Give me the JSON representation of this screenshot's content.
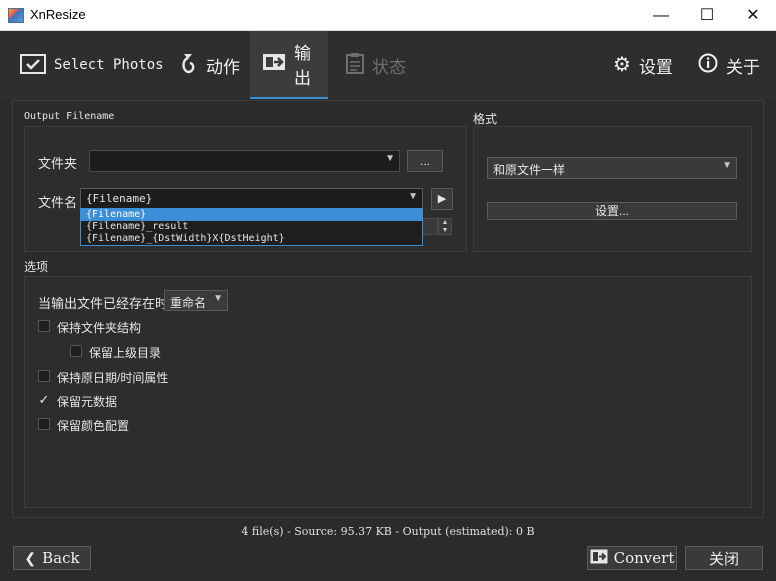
{
  "window": {
    "title": "XnResize",
    "minimize_glyph": "—",
    "maximize_glyph": "☐",
    "close_glyph": "✕"
  },
  "tabs": [
    {
      "label": "Select Photos",
      "icon": "select-photos-icon",
      "state": "normal"
    },
    {
      "label": "动作",
      "icon": "action-icon",
      "state": "normal"
    },
    {
      "label": "输出",
      "icon": "output-icon",
      "state": "active"
    },
    {
      "label": "状态",
      "icon": "status-icon",
      "state": "disabled"
    },
    {
      "label": "设置",
      "icon": "gear-icon",
      "state": "normal"
    },
    {
      "label": "关于",
      "icon": "info-icon",
      "state": "normal"
    }
  ],
  "output_filename": {
    "section_title": "Output Filename",
    "folder_label": "文件夹",
    "folder_value": "",
    "browse_label": "...",
    "filename_label": "文件名",
    "filename_value": "{Filename}",
    "dropdown_options": [
      "{Filename}",
      "{Filename}_result",
      "{Filename}_{DstWidth}X{DstHeight}"
    ],
    "selected_option_index": 0
  },
  "format": {
    "section_title": "格式",
    "value": "和原文件一样",
    "settings_button": "设置..."
  },
  "options": {
    "section_title": "选项",
    "exists_label": "当输出文件已经存在时",
    "exists_value": "重命名",
    "checkboxes": [
      {
        "label": "保持文件夹结构",
        "checked": false
      },
      {
        "label": "保留上级目录",
        "checked": false
      },
      {
        "label": "保持原日期/时间属性",
        "checked": false
      },
      {
        "label": "保留元数据",
        "checked": true
      },
      {
        "label": "保留颜色配置",
        "checked": false
      }
    ]
  },
  "status_text": "4 file(s) - Source: 95.37 KB - Output (estimated): 0 B",
  "footer": {
    "back_label": "Back",
    "convert_label": "Convert",
    "close_label": "关闭"
  },
  "colors": {
    "accent": "#3a8fd6",
    "background": "#2b2b2b"
  }
}
